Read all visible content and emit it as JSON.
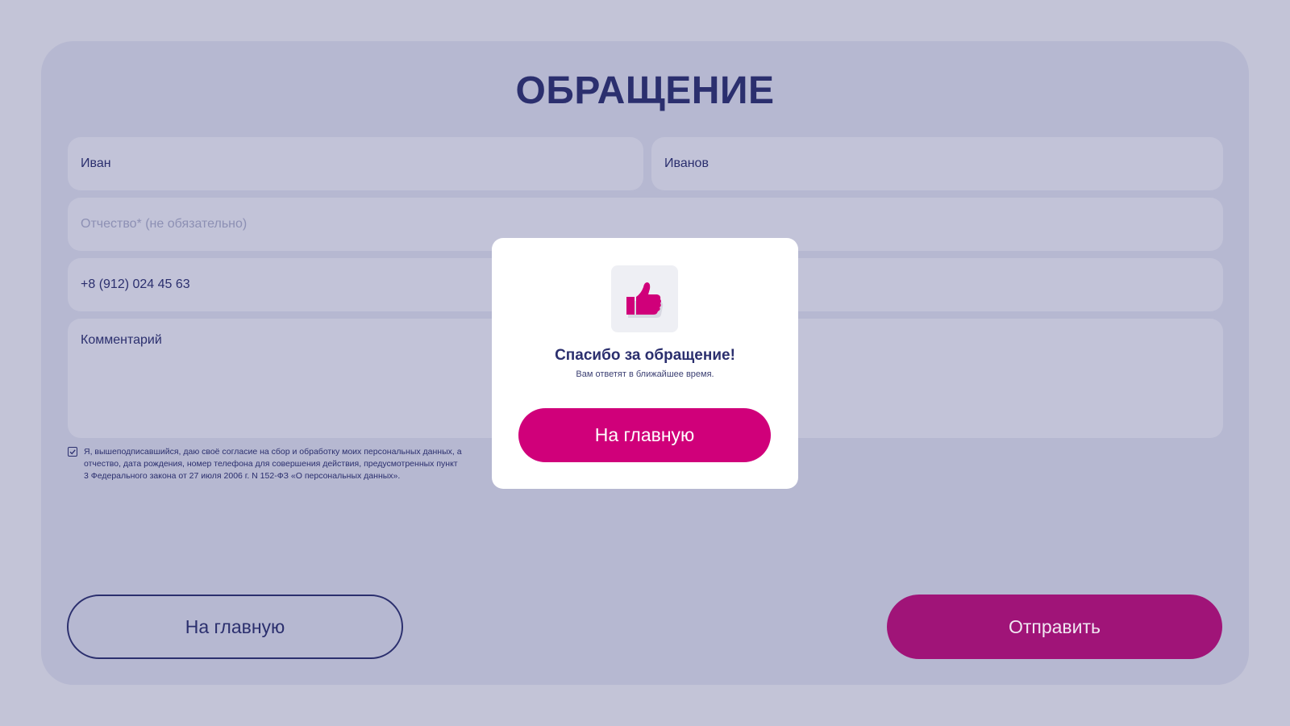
{
  "form": {
    "title": "ОБРАЩЕНИЕ",
    "first_name": {
      "value": "Иван"
    },
    "last_name": {
      "value": "Иванов"
    },
    "patronymic": {
      "placeholder": "Отчество* (не обязательно)"
    },
    "phone": {
      "value": "+8 (912) 024 45 63"
    },
    "comment": {
      "value": "Комментарий"
    },
    "consent": {
      "checked": true,
      "text": "Я, вышеподписавшийся, даю своё согласие на сбор и обработку моих персональных данных, а\nотчество, дата рождения, номер телефона для совершения действия, предусмотренных пункт\n3 Федерального закона от 27 июля 2006 г. N 152-ФЗ «О персональных данных»."
    },
    "buttons": {
      "home_label": "На главную",
      "submit_label": "Отправить"
    }
  },
  "modal": {
    "icon": "thumbs-up-icon",
    "title": "Спасибо за обращение!",
    "subtitle": "Вам ответят в ближайшее время.",
    "button_label": "На главную"
  },
  "colors": {
    "page_bg": "#c3c4d7",
    "card_bg": "#b6b8d1",
    "field_bg": "#c2c3d8",
    "text_primary": "#2b2f6e",
    "accent": "#d0007a",
    "accent_dimmed": "#a01478",
    "modal_bg": "#ffffff"
  }
}
